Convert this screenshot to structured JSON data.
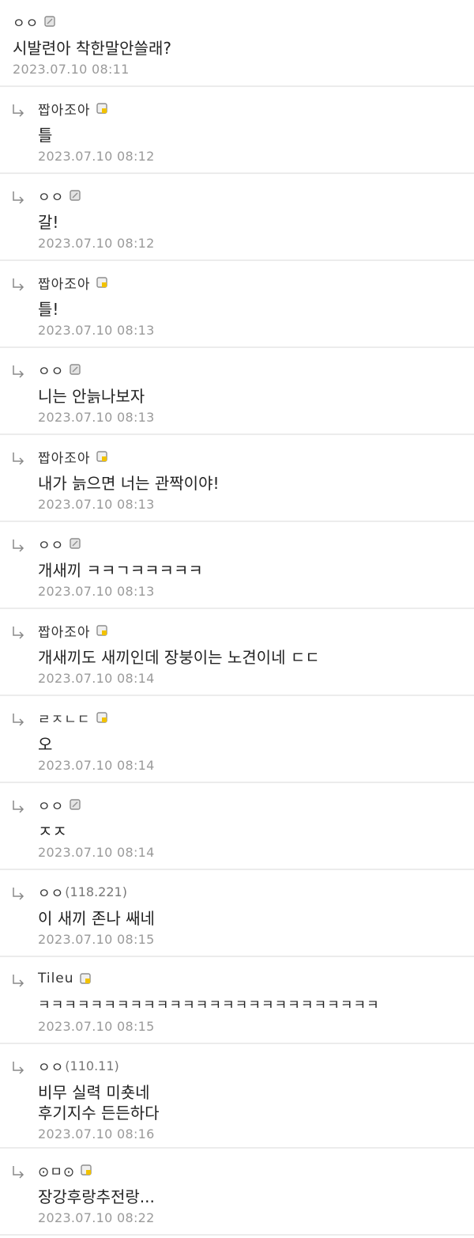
{
  "comments": [
    {
      "type": "top",
      "nick": "ㅇㅇ",
      "ip": "",
      "badge": "gray",
      "body": "시발련아 착한말안쓸래?",
      "time": "2023.07.10 08:11"
    },
    {
      "type": "reply",
      "nick": "짭아조아",
      "ip": "",
      "badge": "gold",
      "body": "틀",
      "time": "2023.07.10 08:12"
    },
    {
      "type": "reply",
      "nick": "ㅇㅇ",
      "ip": "",
      "badge": "gray",
      "body": "갈!",
      "time": "2023.07.10 08:12"
    },
    {
      "type": "reply",
      "nick": "짭아조아",
      "ip": "",
      "badge": "gold",
      "body": "틀!",
      "time": "2023.07.10 08:13"
    },
    {
      "type": "reply",
      "nick": "ㅇㅇ",
      "ip": "",
      "badge": "gray",
      "body": "니는 안늙나보자",
      "time": "2023.07.10 08:13"
    },
    {
      "type": "reply",
      "nick": "짭아조아",
      "ip": "",
      "badge": "gold",
      "body": "내가 늙으면 너는 관짝이야!",
      "time": "2023.07.10 08:13"
    },
    {
      "type": "reply",
      "nick": "ㅇㅇ",
      "ip": "",
      "badge": "gray",
      "body": "개새끼 ㅋㅋㄱㅋㅋㅋㅋㅋ",
      "time": "2023.07.10 08:13"
    },
    {
      "type": "reply",
      "nick": "짭아조아",
      "ip": "",
      "badge": "gold",
      "body": "개새끼도 새끼인데 장붕이는 노견이네 ㄷㄷ",
      "time": "2023.07.10 08:14"
    },
    {
      "type": "reply",
      "nick": "ㄹㅈㄴㄷ",
      "ip": "",
      "badge": "gold",
      "body": "오",
      "time": "2023.07.10 08:14"
    },
    {
      "type": "reply",
      "nick": "ㅇㅇ",
      "ip": "",
      "badge": "gray",
      "body": "ㅈㅈ",
      "time": "2023.07.10 08:14"
    },
    {
      "type": "reply",
      "nick": "ㅇㅇ",
      "ip": "(118.221)",
      "badge": "",
      "body": "이 새끼 존나 쌔네",
      "time": "2023.07.10 08:15"
    },
    {
      "type": "reply",
      "nick": "Tileu",
      "ip": "",
      "badge": "gold",
      "body": "ㅋㅋㅋㅋㅋㅋㅋㅋㅋㅋㅋㅋㅋㅋㅋㅋㅋㅋㅋㅋㅋㅋㅋㅋㅋㅋ",
      "time": "2023.07.10 08:15"
    },
    {
      "type": "reply",
      "nick": "ㅇㅇ",
      "ip": "(110.11)",
      "badge": "",
      "body": "비무 실력 미춋네\n후기지수 든든하다",
      "time": "2023.07.10 08:16"
    },
    {
      "type": "reply",
      "nick": "⊙ㅁ⊙",
      "ip": "",
      "badge": "gold",
      "body": "장강후랑추전랑...",
      "time": "2023.07.10 08:22"
    }
  ]
}
